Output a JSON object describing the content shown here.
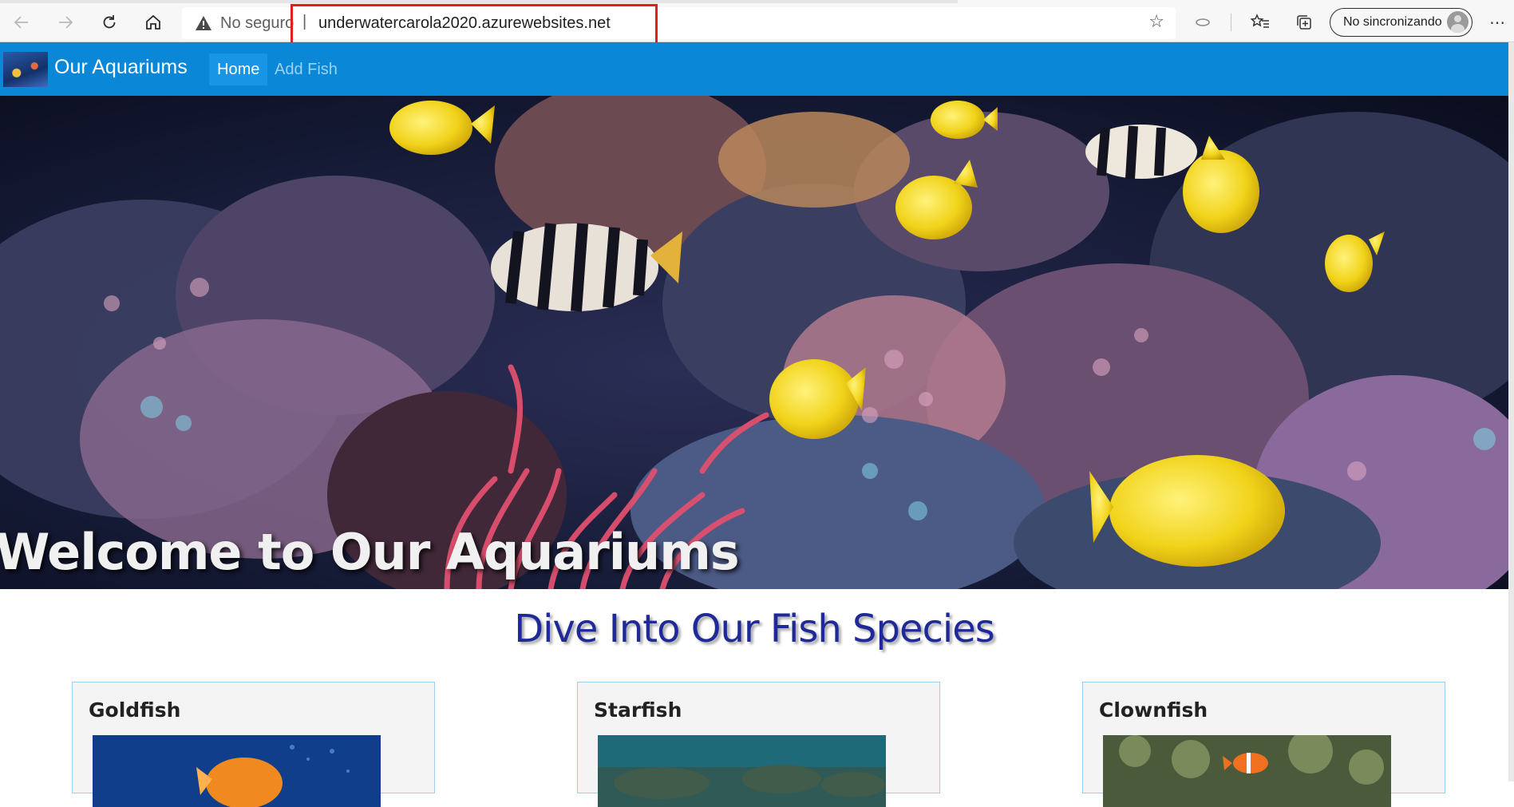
{
  "browser": {
    "insecure_label": "No seguro",
    "separator": "|",
    "url": "underwatercarola2020.azurewebsites.net",
    "profile_label": "No sincronizando"
  },
  "site": {
    "brand": "Our Aquariums",
    "nav": [
      {
        "label": "Home",
        "active": true
      },
      {
        "label": "Add Fish",
        "active": false
      }
    ]
  },
  "hero": {
    "title": "Welcome to Our Aquariums"
  },
  "species": {
    "heading": "Dive Into Our Fish Species",
    "cards": [
      {
        "name": "Goldfish"
      },
      {
        "name": "Starfish"
      },
      {
        "name": "Clownfish"
      }
    ]
  },
  "colors": {
    "navbar": "#0a87d6",
    "heading": "#1f2a98",
    "highlight": "#e02020"
  }
}
